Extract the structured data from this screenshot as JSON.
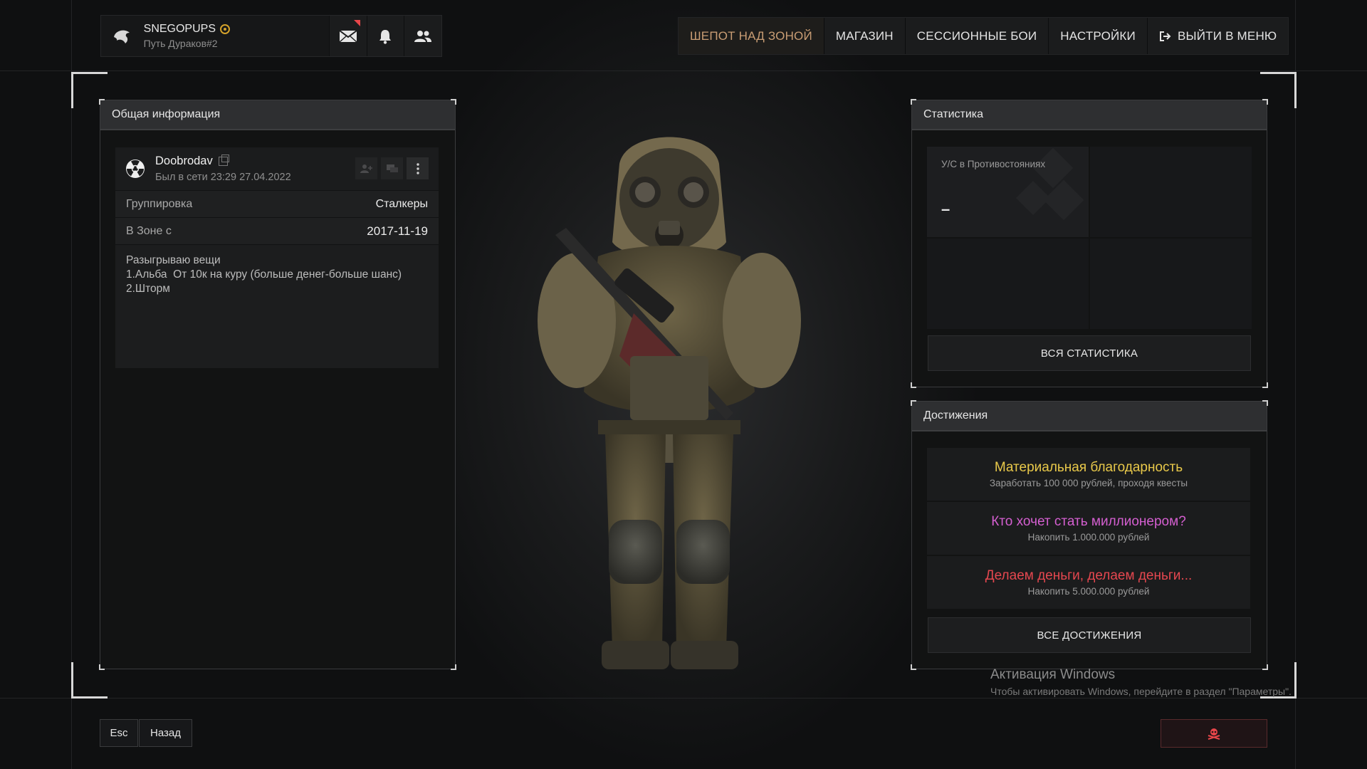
{
  "header": {
    "username": "SNEGOPUPS",
    "subtitle": "Путь Дураков#2",
    "nav": [
      "ШЕПОТ НАД ЗОНОЙ",
      "МАГАЗИН",
      "СЕССИОННЫЕ БОИ",
      "НАСТРОЙКИ",
      "ВЫЙТИ В МЕНЮ"
    ]
  },
  "general": {
    "title": "Общая информация",
    "player_name": "Doobrodav",
    "last_seen": "Был в сети 23:29 27.04.2022",
    "faction_label": "Группировка",
    "faction_value": "Сталкеры",
    "zone_label": "В Зоне с",
    "zone_value": "2017-11-19",
    "description": [
      "Разыгрываю вещи",
      "1.Альба  От 10к на куру (больше денег-больше шанс)",
      "2.Шторм"
    ]
  },
  "stats": {
    "title": "Статистика",
    "kd_label": "У/С в Противостояниях",
    "kd_value": "–",
    "all_button": "ВСЯ СТАТИСТИКА"
  },
  "achievements": {
    "title": "Достижения",
    "items": [
      {
        "title": "Материальная благодарность",
        "desc": "Заработать 100 000 рублей, проходя квесты",
        "color": "#e9c94a"
      },
      {
        "title": "Кто хочет стать миллионером?",
        "desc": "Накопить 1.000.000 рублей",
        "color": "#d45fd0"
      },
      {
        "title": "Делаем деньги, делаем деньги...",
        "desc": "Накопить 5.000.000 рублей",
        "color": "#e5474f"
      }
    ],
    "all_button": "ВСЕ ДОСТИЖЕНИЯ"
  },
  "footer": {
    "esc_key": "Esc",
    "back_label": "Назад"
  },
  "watermark": {
    "title": "Активация Windows",
    "text": "Чтобы активировать Windows, перейдите в раздел \"Параметры\"."
  },
  "colors": {
    "accent": "#c99d74",
    "flag": "#e8464a",
    "report": "#e8464a"
  }
}
